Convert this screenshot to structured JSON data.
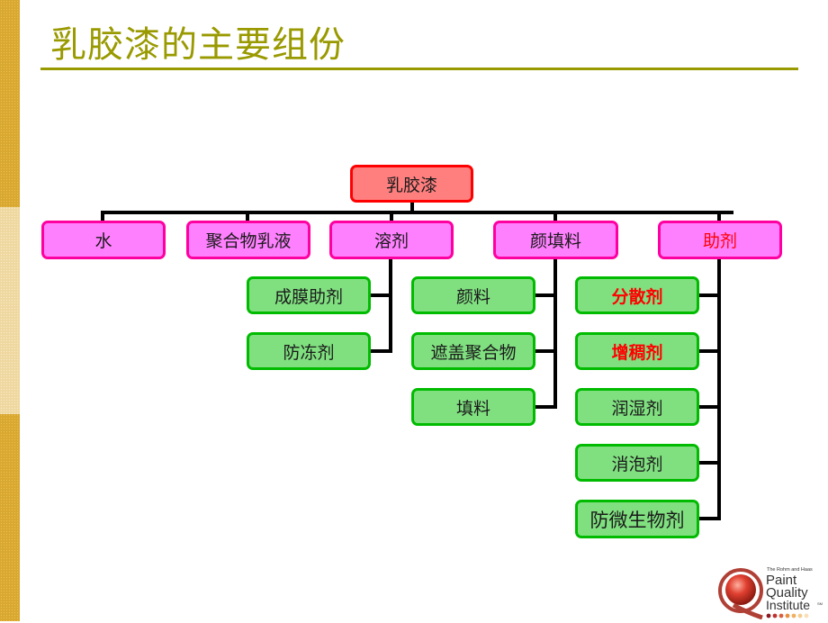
{
  "slide": {
    "title": "乳胶漆的主要组份",
    "colors": {
      "title": "#999900",
      "root_fill": "#FF7F7F",
      "root_border": "#FF0000",
      "level1_fill": "#FF80FF",
      "level1_border": "#FF00A0",
      "level2_fill": "#80E080",
      "level2_border": "#00BB00",
      "highlight_text": "#FF0000",
      "connector": "#000000"
    }
  },
  "diagram": {
    "root": {
      "label": "乳胶漆"
    },
    "categories": [
      {
        "label": "水",
        "highlight": false,
        "children": []
      },
      {
        "label": "聚合物乳液",
        "highlight": false,
        "children": []
      },
      {
        "label": "溶剂",
        "highlight": false,
        "children": [
          {
            "label": "成膜助剂",
            "highlight": false
          },
          {
            "label": "防冻剂",
            "highlight": false
          }
        ]
      },
      {
        "label": "颜填料",
        "highlight": false,
        "children": [
          {
            "label": "颜料",
            "highlight": false
          },
          {
            "label": "遮盖聚合物",
            "highlight": false
          },
          {
            "label": "填料",
            "highlight": false
          }
        ]
      },
      {
        "label": "助剂",
        "highlight": true,
        "children": [
          {
            "label": "分散剂",
            "highlight": true
          },
          {
            "label": "增稠剂",
            "highlight": true
          },
          {
            "label": "润湿剂",
            "highlight": false
          },
          {
            "label": "消泡剂",
            "highlight": false
          },
          {
            "label": "防微生物剂",
            "highlight": false
          }
        ]
      }
    ]
  },
  "logo": {
    "line1": "The Rohm and Haas",
    "line2": "Paint",
    "line3": "Quality",
    "line4": "Institute",
    "mark": "SM",
    "icon": "q-sphere-logo-icon"
  }
}
